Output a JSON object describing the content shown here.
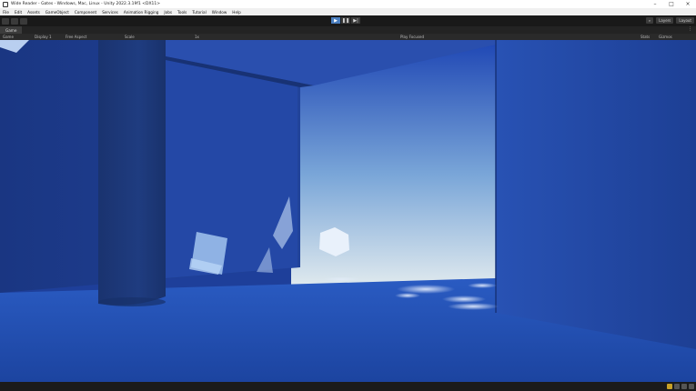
{
  "window": {
    "title": "Wide Reader - Gates - Windows, Mac, Linux - Unity 2022.3.19f1 <DX11>",
    "controls": [
      "–",
      "□",
      "×"
    ]
  },
  "menu": [
    "File",
    "Edit",
    "Assets",
    "GameObject",
    "Component",
    "Services",
    "Animation Rigging",
    "Jobs",
    "Tools",
    "Tutorial",
    "Window",
    "Help"
  ],
  "toolbar": {
    "play": "▶",
    "pause": "❚❚",
    "step": "▶|",
    "layers": "Layers",
    "layout": "Layout"
  },
  "game_view": {
    "tab": "Game",
    "display_mode": "Game",
    "display": "Display 1",
    "aspect": "Free Aspect",
    "scale_label": "Scale",
    "scale_value": "1x",
    "play_focused": "Play Focused",
    "stats": "Stats",
    "gizmos": "Gizmos"
  },
  "colors": {
    "sky_top": "#1e46b4",
    "sky_bottom": "#dfe9ee",
    "wall_dark": "#1c3880",
    "wall_mid": "#2449a6",
    "floor": "#2250b4",
    "highlight": "#d8ecff",
    "toolbar_accent": "#4a7ebf"
  }
}
